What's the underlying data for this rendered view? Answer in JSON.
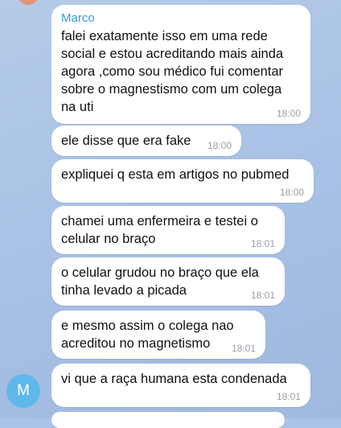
{
  "chat": {
    "sender_name": "Marco",
    "avatar_initial": "M",
    "messages": [
      {
        "text": "falei exatamente isso em uma rede\nsocial e estou acreditando mais ainda\nagora ,como sou médico fui comentar\nsobre o magnestismo com um colega\nna uti",
        "time": "18:00"
      },
      {
        "text": "ele disse que era fake",
        "time": "18:00"
      },
      {
        "text": "expliquei q esta em artigos no pubmed",
        "time": "18:00"
      },
      {
        "text": "chamei uma enfermeira e testei o\ncelular no braço",
        "time": "18:01"
      },
      {
        "text": "o celular grudou no braço que ela\ntinha levado a picada",
        "time": "18:01"
      },
      {
        "text": "e mesmo assim o colega nao\nacreditou no magnetismo",
        "time": "18:01"
      },
      {
        "text": "vi que a raça humana esta condenada",
        "time": "18:01"
      }
    ]
  },
  "colors": {
    "background": "#a9c3e6",
    "bubble": "#ffffff",
    "sender_name": "#3a9bd5",
    "avatar": "#5fb8ea",
    "timestamp": "#9aa1a8"
  }
}
